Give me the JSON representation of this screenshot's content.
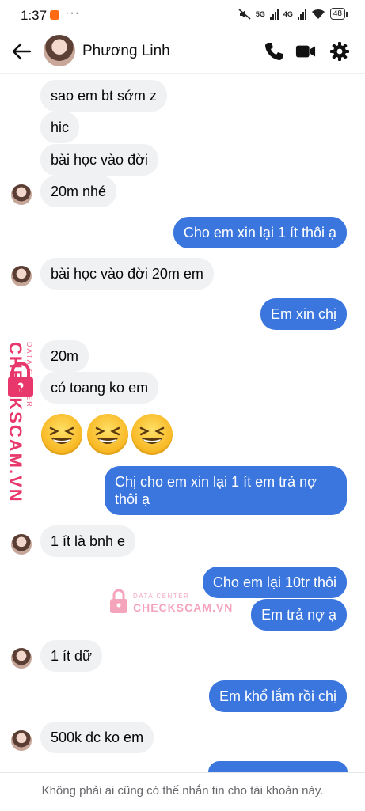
{
  "status_bar": {
    "time": "1:37",
    "more": "···",
    "net1": "5G",
    "net2": "4G",
    "battery": "48"
  },
  "header": {
    "contact_name": "Phương Linh"
  },
  "messages": [
    {
      "dir": "in",
      "text": "sao em bt sớm z"
    },
    {
      "dir": "in",
      "text": "hic"
    },
    {
      "dir": "in",
      "text": "bài học vào đời"
    },
    {
      "dir": "in",
      "text": "20m nhé"
    },
    {
      "dir": "out",
      "text": "Cho em xin lại 1 ít thôi ạ"
    },
    {
      "dir": "in",
      "text": "bài học vào đời 20m em"
    },
    {
      "dir": "out",
      "text": "Em xin chị"
    },
    {
      "dir": "in",
      "text": "20m"
    },
    {
      "dir": "in",
      "text": "có toang ko em"
    },
    {
      "dir": "in",
      "text": "😆😆😆"
    },
    {
      "dir": "out",
      "text_line1": "Chị cho em xin lại 1 ít em trả nợ",
      "text_line2": "thôi ạ"
    },
    {
      "dir": "in",
      "text": "1 ít là bnh e"
    },
    {
      "dir": "out",
      "text": "Cho em lại 10tr thôi"
    },
    {
      "dir": "out",
      "text": "Em trả nợ ạ"
    },
    {
      "dir": "in",
      "text": "1 ít dữ"
    },
    {
      "dir": "out",
      "text": "Em khổ lắm rồi chị"
    },
    {
      "dir": "in",
      "text": "500k đc ko em"
    }
  ],
  "watermark": {
    "small": "DATA CENTER",
    "brand": "CHECKSCAM.VN",
    "color": "#e8376b"
  },
  "footer": {
    "notice": "Không phải ai cũng có thể nhắn tin cho tài khoản này."
  },
  "colors": {
    "outgoing_bubble": "#3a76de",
    "incoming_bubble": "#f0f1f3"
  }
}
